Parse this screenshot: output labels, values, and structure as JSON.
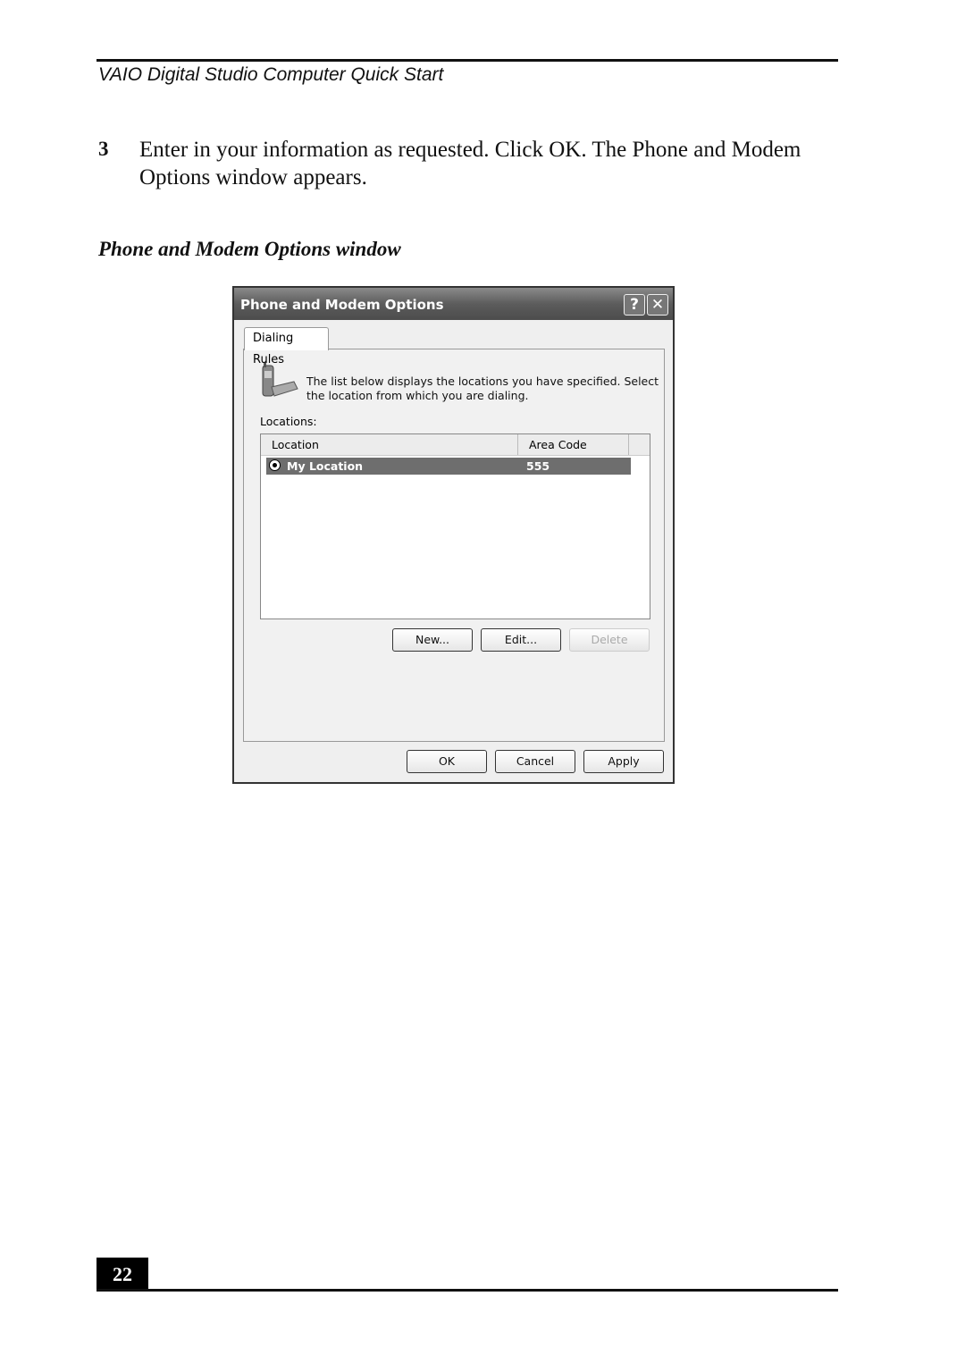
{
  "header": {
    "title": "VAIO Digital Studio Computer Quick Start"
  },
  "step": {
    "number": "3",
    "text": "Enter in your information as requested. Click OK. The Phone and Modem Options window appears."
  },
  "caption": "Phone and Modem Options window",
  "dialog": {
    "title": "Phone and Modem Options",
    "help_label": "?",
    "close_label": "✕",
    "tabs": [
      {
        "label": "Dialing Rules",
        "selected": true
      }
    ],
    "description": "The list below displays the locations you have specified. Select the location from which you are dialing.",
    "locations_label": "Locations:",
    "columns": [
      "Location",
      "Area Code"
    ],
    "rows": [
      {
        "location": "My Location",
        "area_code": "555",
        "selected": true
      }
    ],
    "buttons": {
      "new": "New...",
      "edit": "Edit...",
      "delete": "Delete",
      "ok": "OK",
      "cancel": "Cancel",
      "apply": "Apply"
    }
  },
  "footer": {
    "page_number": "22"
  }
}
